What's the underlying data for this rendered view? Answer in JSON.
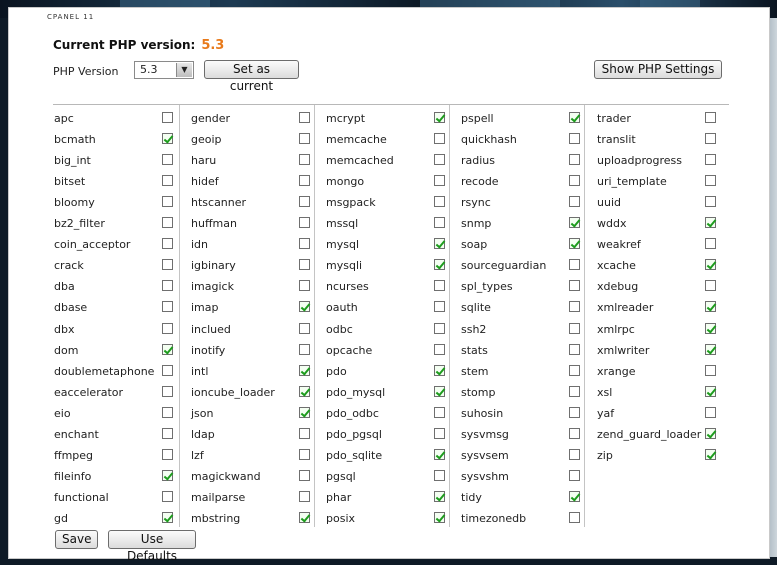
{
  "panel": {
    "title": "CPANEL 11"
  },
  "current": {
    "label": "Current PHP version:",
    "value": "5.3"
  },
  "version_picker": {
    "label": "PHP Version",
    "selected": "5.3",
    "set_label": "Set as current"
  },
  "show_settings_label": "Show PHP Settings",
  "footer": {
    "save_label": "Save",
    "defaults_label": "Use Defaults"
  },
  "colors": {
    "accent_orange": "#e87a1b",
    "check_green": "#1d9c1d"
  },
  "extension_columns": [
    [
      {
        "name": "apc",
        "checked": false
      },
      {
        "name": "bcmath",
        "checked": true
      },
      {
        "name": "big_int",
        "checked": false
      },
      {
        "name": "bitset",
        "checked": false
      },
      {
        "name": "bloomy",
        "checked": false
      },
      {
        "name": "bz2_filter",
        "checked": false
      },
      {
        "name": "coin_acceptor",
        "checked": false
      },
      {
        "name": "crack",
        "checked": false
      },
      {
        "name": "dba",
        "checked": false
      },
      {
        "name": "dbase",
        "checked": false
      },
      {
        "name": "dbx",
        "checked": false
      },
      {
        "name": "dom",
        "checked": true
      },
      {
        "name": "doublemetaphone",
        "checked": false
      },
      {
        "name": "eaccelerator",
        "checked": false
      },
      {
        "name": "eio",
        "checked": false
      },
      {
        "name": "enchant",
        "checked": false
      },
      {
        "name": "ffmpeg",
        "checked": false
      },
      {
        "name": "fileinfo",
        "checked": true
      },
      {
        "name": "functional",
        "checked": false
      },
      {
        "name": "gd",
        "checked": true
      }
    ],
    [
      {
        "name": "gender",
        "checked": false
      },
      {
        "name": "geoip",
        "checked": false
      },
      {
        "name": "haru",
        "checked": false
      },
      {
        "name": "hidef",
        "checked": false
      },
      {
        "name": "htscanner",
        "checked": false
      },
      {
        "name": "huffman",
        "checked": false
      },
      {
        "name": "idn",
        "checked": false
      },
      {
        "name": "igbinary",
        "checked": false
      },
      {
        "name": "imagick",
        "checked": false
      },
      {
        "name": "imap",
        "checked": true
      },
      {
        "name": "inclued",
        "checked": false
      },
      {
        "name": "inotify",
        "checked": false
      },
      {
        "name": "intl",
        "checked": true
      },
      {
        "name": "ioncube_loader",
        "checked": true
      },
      {
        "name": "json",
        "checked": true
      },
      {
        "name": "ldap",
        "checked": false
      },
      {
        "name": "lzf",
        "checked": false
      },
      {
        "name": "magickwand",
        "checked": false
      },
      {
        "name": "mailparse",
        "checked": false
      },
      {
        "name": "mbstring",
        "checked": true
      }
    ],
    [
      {
        "name": "mcrypt",
        "checked": true
      },
      {
        "name": "memcache",
        "checked": false
      },
      {
        "name": "memcached",
        "checked": false
      },
      {
        "name": "mongo",
        "checked": false
      },
      {
        "name": "msgpack",
        "checked": false
      },
      {
        "name": "mssql",
        "checked": false
      },
      {
        "name": "mysql",
        "checked": true
      },
      {
        "name": "mysqli",
        "checked": true
      },
      {
        "name": "ncurses",
        "checked": false
      },
      {
        "name": "oauth",
        "checked": false
      },
      {
        "name": "odbc",
        "checked": false
      },
      {
        "name": "opcache",
        "checked": false
      },
      {
        "name": "pdo",
        "checked": true
      },
      {
        "name": "pdo_mysql",
        "checked": true
      },
      {
        "name": "pdo_odbc",
        "checked": false
      },
      {
        "name": "pdo_pgsql",
        "checked": false
      },
      {
        "name": "pdo_sqlite",
        "checked": true
      },
      {
        "name": "pgsql",
        "checked": false
      },
      {
        "name": "phar",
        "checked": true
      },
      {
        "name": "posix",
        "checked": true
      }
    ],
    [
      {
        "name": "pspell",
        "checked": true
      },
      {
        "name": "quickhash",
        "checked": false
      },
      {
        "name": "radius",
        "checked": false
      },
      {
        "name": "recode",
        "checked": false
      },
      {
        "name": "rsync",
        "checked": false
      },
      {
        "name": "snmp",
        "checked": true
      },
      {
        "name": "soap",
        "checked": true
      },
      {
        "name": "sourceguardian",
        "checked": false
      },
      {
        "name": "spl_types",
        "checked": false
      },
      {
        "name": "sqlite",
        "checked": false
      },
      {
        "name": "ssh2",
        "checked": false
      },
      {
        "name": "stats",
        "checked": false
      },
      {
        "name": "stem",
        "checked": false
      },
      {
        "name": "stomp",
        "checked": false
      },
      {
        "name": "suhosin",
        "checked": false
      },
      {
        "name": "sysvmsg",
        "checked": false
      },
      {
        "name": "sysvsem",
        "checked": false
      },
      {
        "name": "sysvshm",
        "checked": false
      },
      {
        "name": "tidy",
        "checked": true
      },
      {
        "name": "timezonedb",
        "checked": false
      }
    ],
    [
      {
        "name": "trader",
        "checked": false
      },
      {
        "name": "translit",
        "checked": false
      },
      {
        "name": "uploadprogress",
        "checked": false
      },
      {
        "name": "uri_template",
        "checked": false
      },
      {
        "name": "uuid",
        "checked": false
      },
      {
        "name": "wddx",
        "checked": true
      },
      {
        "name": "weakref",
        "checked": false
      },
      {
        "name": "xcache",
        "checked": true
      },
      {
        "name": "xdebug",
        "checked": false
      },
      {
        "name": "xmlreader",
        "checked": true
      },
      {
        "name": "xmlrpc",
        "checked": true
      },
      {
        "name": "xmlwriter",
        "checked": true
      },
      {
        "name": "xrange",
        "checked": false
      },
      {
        "name": "xsl",
        "checked": true
      },
      {
        "name": "yaf",
        "checked": false
      },
      {
        "name": "zend_guard_loader",
        "checked": true
      },
      {
        "name": "zip",
        "checked": true
      }
    ]
  ]
}
